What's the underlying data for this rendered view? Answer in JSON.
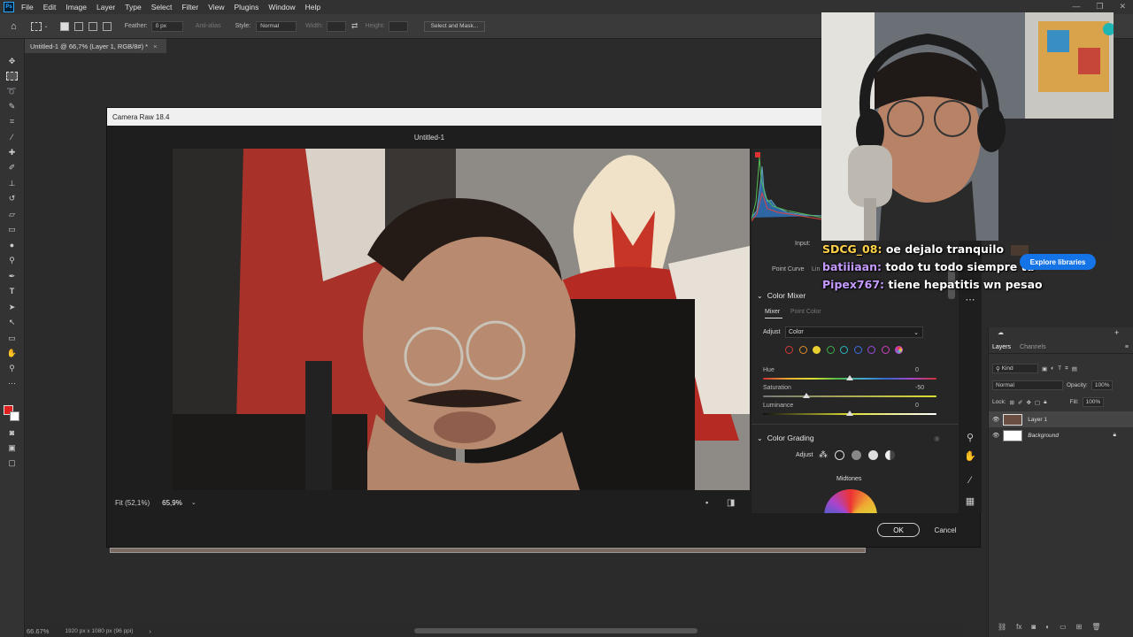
{
  "menubar": {
    "logo": "Ps",
    "items": [
      "File",
      "Edit",
      "Image",
      "Layer",
      "Type",
      "Select",
      "Filter",
      "View",
      "Plugins",
      "Window",
      "Help"
    ]
  },
  "options_bar": {
    "feather_label": "Feather:",
    "feather_value": "0 px",
    "antialias_label": "Anti-alias",
    "style_label": "Style:",
    "style_value": "Normal",
    "width_label": "Width:",
    "height_label": "Height:",
    "select_mask_button": "Select and Mask..."
  },
  "document_tab": {
    "title": "Untitled-1 @ 66,7% (Layer 1, RGB/8#) *",
    "close": "×"
  },
  "status_bar": {
    "zoom": "66.67%",
    "doc_info": "1920 px x 1080 px (96 ppi)"
  },
  "camera_raw": {
    "window_title": "Camera Raw 18.4",
    "doc_name": "Untitled-1",
    "fit_label": "Fit (52,1%)",
    "zoom_value": "65,9%",
    "ok_button": "OK",
    "cancel_button": "Cancel",
    "input_label": "Input:",
    "point_curve_label": "Point Curve",
    "point_curve_value": "Lin",
    "color_mixer": {
      "title": "Color Mixer",
      "tab_mixer": "Mixer",
      "tab_point_color": "Point Color",
      "adjust_label": "Adjust",
      "adjust_value": "Color",
      "color_swatches": [
        "#d03a3a",
        "#e08a2a",
        "#e8d030",
        "#3cb04a",
        "#2ab8c0",
        "#3a6ee0",
        "#9a4ae0",
        "#d040c0",
        "multi"
      ],
      "selected_swatch": 2,
      "sliders": [
        {
          "label": "Hue",
          "value": "0",
          "level": 0.5
        },
        {
          "label": "Saturation",
          "value": "-50",
          "level": 0.25
        },
        {
          "label": "Luminance",
          "value": "0",
          "level": 0.5
        }
      ]
    },
    "color_grading": {
      "title": "Color Grading",
      "adjust_label": "Adjust",
      "midtones_label": "Midtones"
    }
  },
  "layers_panel": {
    "tab_layers": "Layers",
    "tab_channels": "Channels",
    "kind_label": "Kind",
    "blend_mode": "Normal",
    "opacity_label": "Opacity:",
    "opacity_value": "100%",
    "lock_label": "Lock:",
    "fill_label": "Fill:",
    "fill_value": "100%",
    "layers": [
      {
        "name": "Layer 1"
      },
      {
        "name": "Background"
      }
    ]
  },
  "explore_button": "Explore libraries",
  "chat": [
    {
      "user": "SDCG_08:",
      "message": " oe dejalo tranquilo",
      "color": "#ffd24a"
    },
    {
      "user": "batiiiaan:",
      "message": " todo tu todo siempre tu",
      "color": "#c59bff"
    },
    {
      "user": "Pipex767:",
      "message": " tiene hepatitis wn pesao",
      "color": "#c59bff"
    }
  ]
}
